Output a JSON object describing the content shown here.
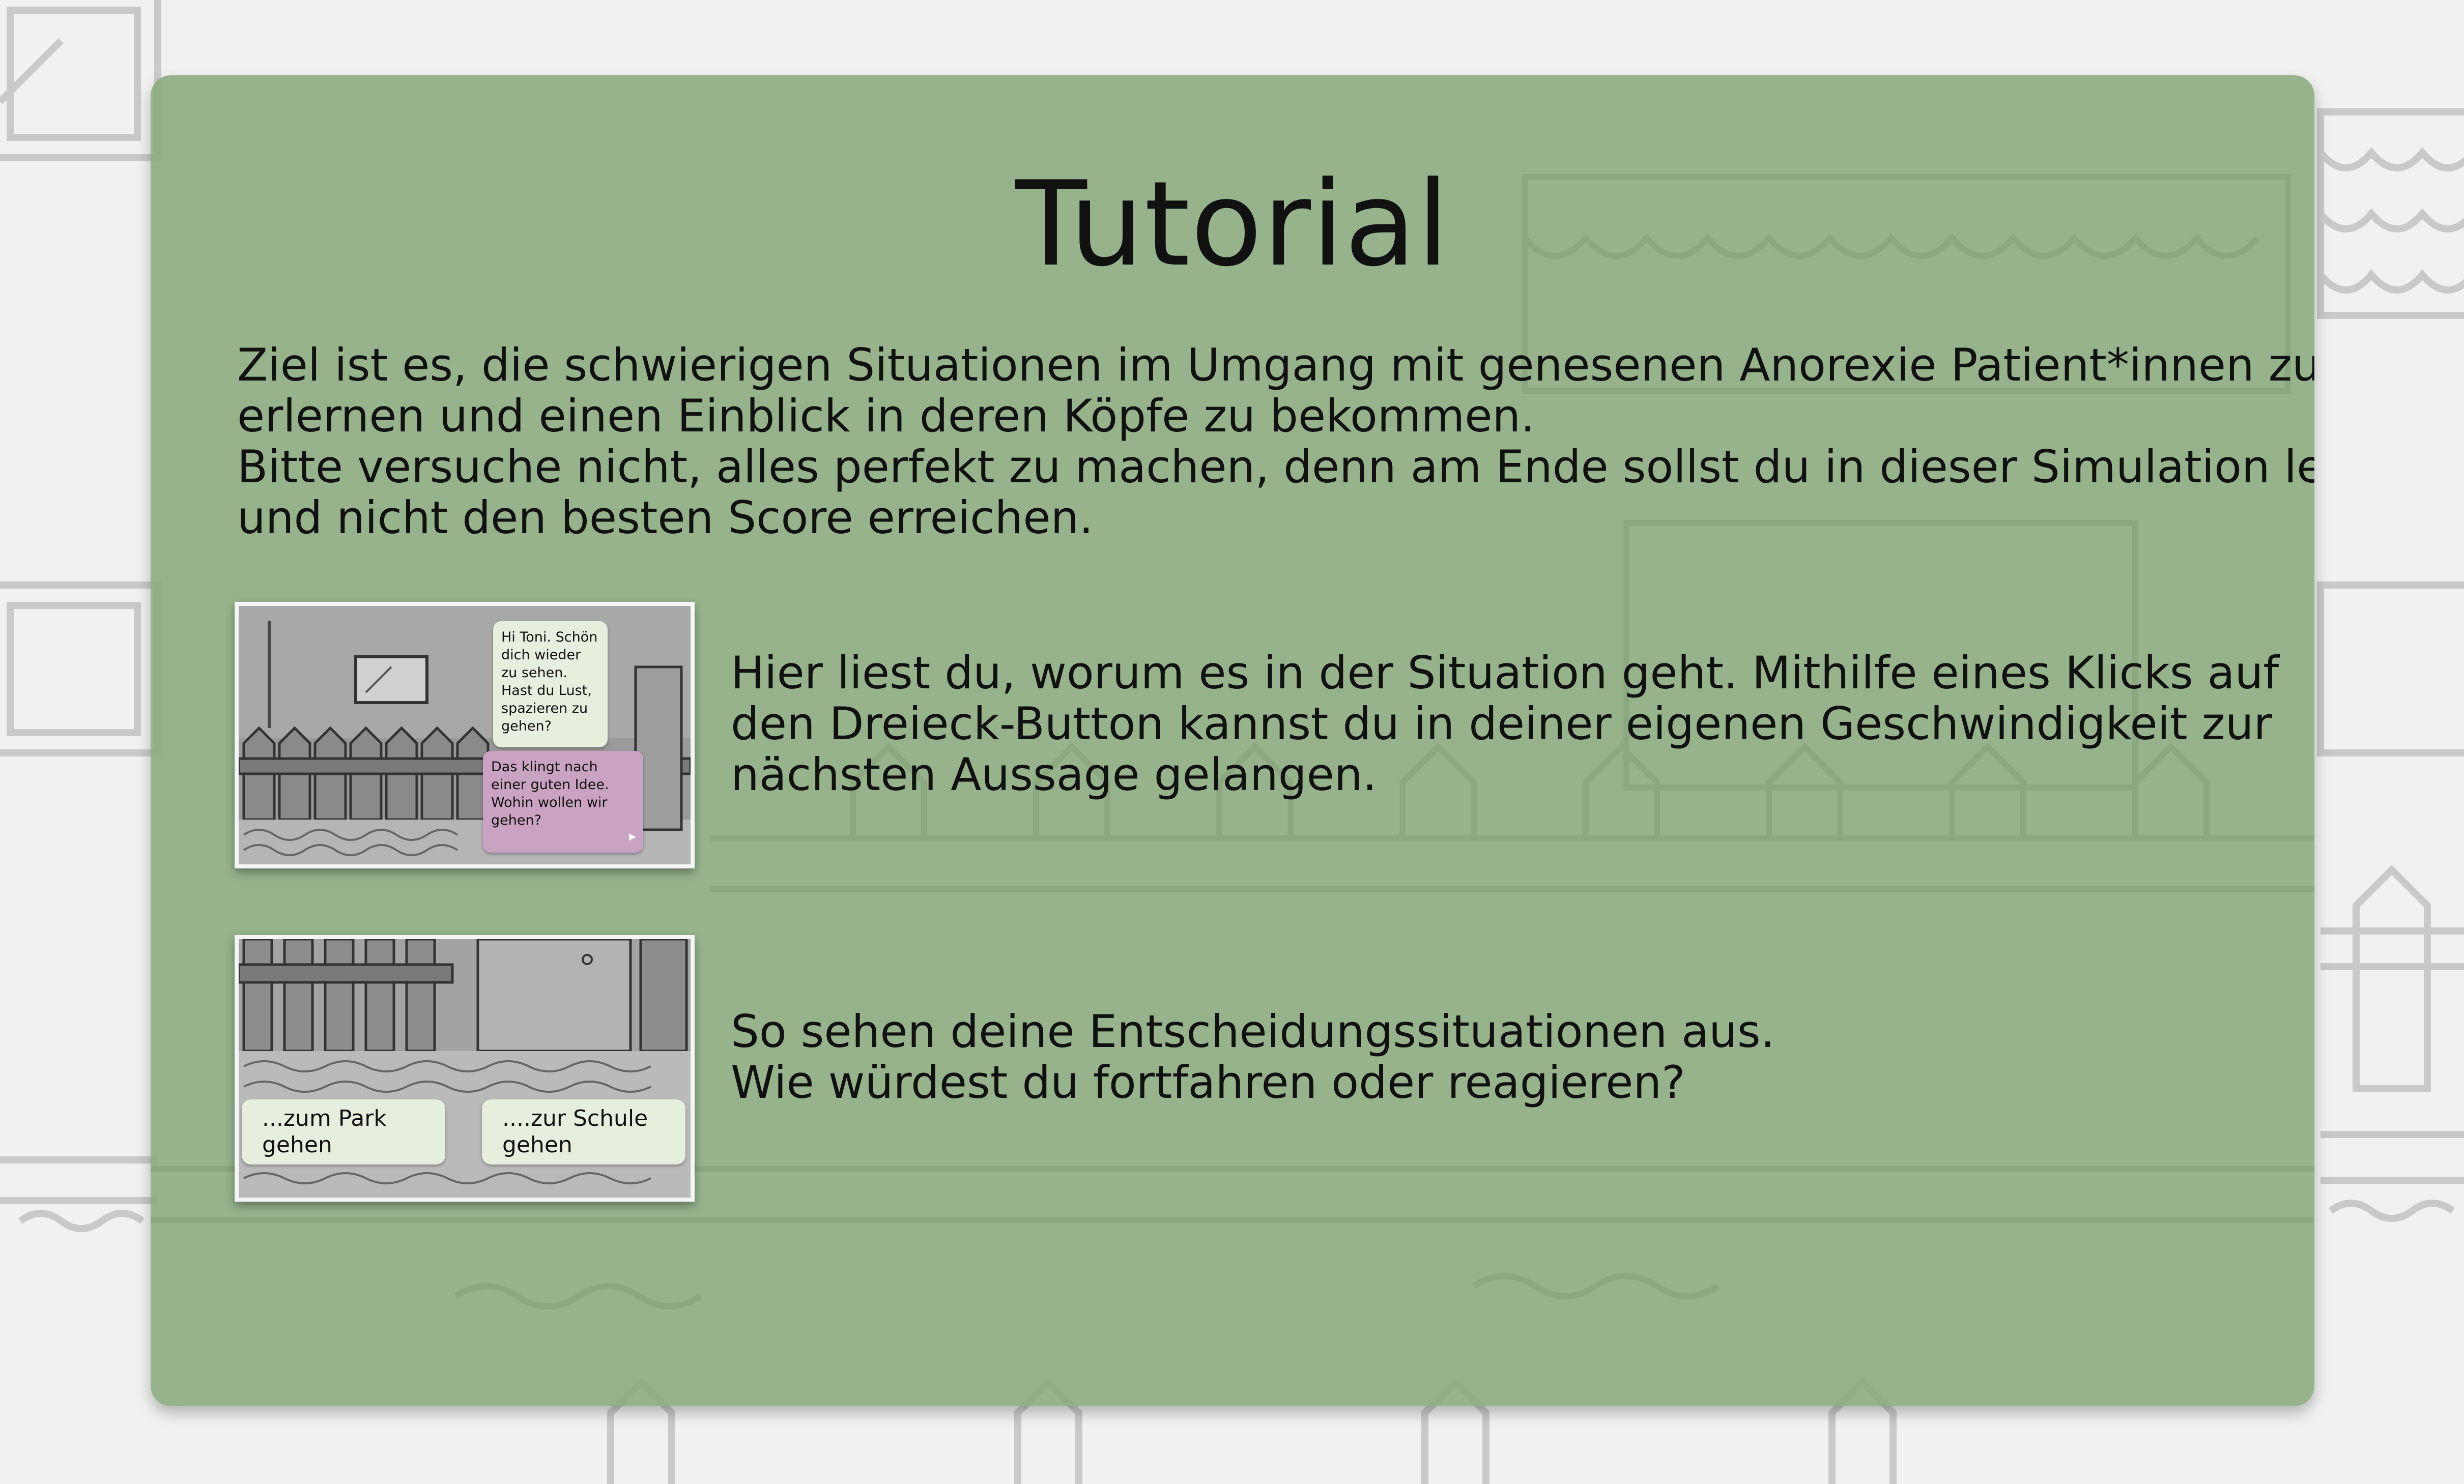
{
  "tutorial": {
    "title": "Tutorial",
    "intro_lines": [
      "Ziel ist es, die schwierigen Situationen im Umgang mit genesenen Anorexie Patient*innen zu",
      "erlernen und einen Einblick in deren Köpfe zu bekommen.",
      "Bitte versuche nicht, alles perfekt zu machen, denn am Ende sollst du in dieser Simulation lernen",
      "und nicht den besten Score erreichen."
    ],
    "example1": {
      "bubble_green": "Hi Toni. Schön dich wieder zu sehen. Hast du Lust, spazieren zu gehen?",
      "bubble_pink": "Das klingt nach einer guten Idee. Wohin wollen wir gehen?",
      "play_icon": "triangle-play-icon",
      "description_lines": [
        "Hier liest du, worum es in der Situation geht. Mithilfe eines Klicks auf",
        "den Dreieck-Button kannst du in deiner eigenen Geschwindigkeit zur",
        "nächsten Aussage gelangen."
      ]
    },
    "example2": {
      "choices": [
        "...zum Park gehen",
        "....zur Schule gehen"
      ],
      "description_lines": [
        "So sehen deine Entscheidungssituationen aus.",
        "Wie würdest du fortfahren oder reagieren?"
      ]
    }
  },
  "colors": {
    "panel": "#89aa7d",
    "background": "#f1f1f1",
    "bubble_green": "#e6eede",
    "bubble_pink": "#c9a3c1",
    "sketch_lines": "#cfcfcf"
  }
}
